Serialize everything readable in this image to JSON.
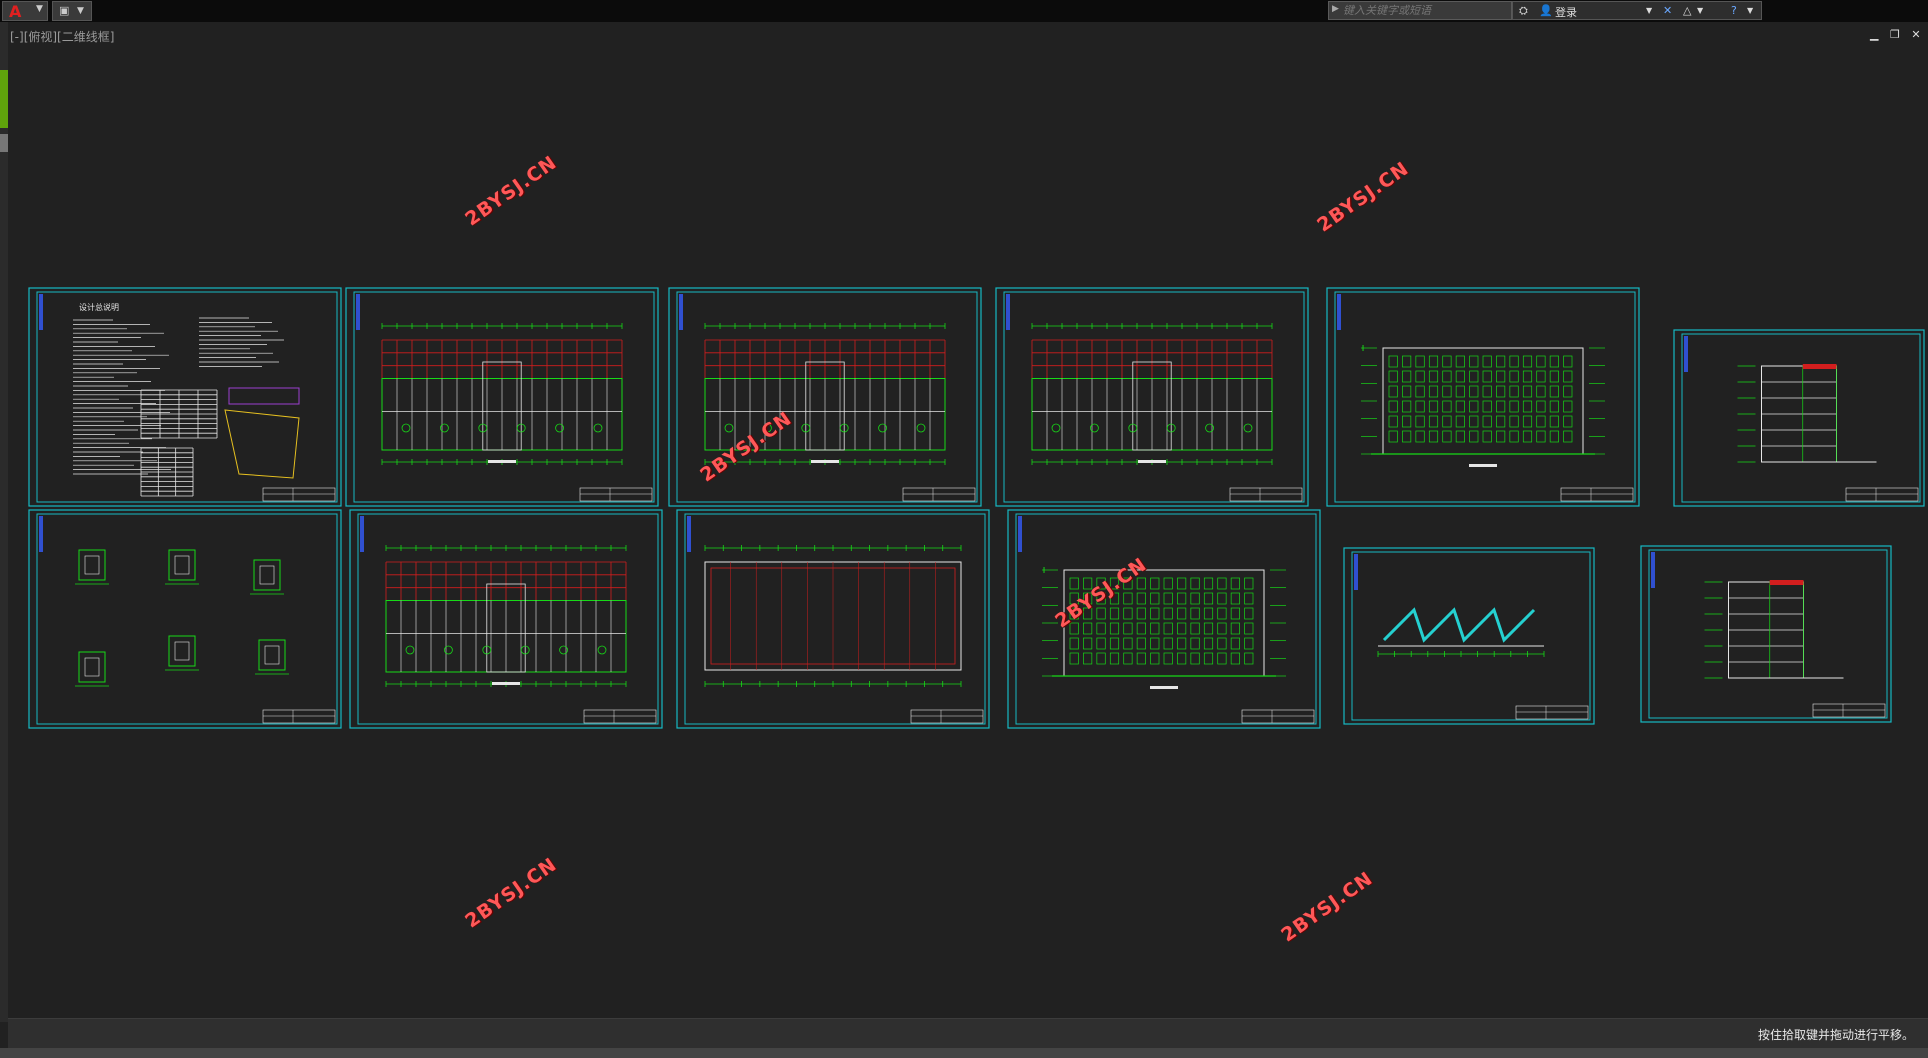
{
  "app": {
    "logo_glyph": "A",
    "quick_access_icons": [
      "save-icon",
      "dropdown-icon"
    ]
  },
  "search": {
    "placeholder": "键入关键字或短语"
  },
  "toolbar_right": {
    "login_label": "登录",
    "icons": [
      "binoculars-icon",
      "user-icon",
      "exchange-icon",
      "network-icon",
      "help-icon"
    ]
  },
  "viewport": {
    "label": "[-][俯视][二维线框]"
  },
  "watermarks": [
    "2BYSJ.CN",
    "2BYSJ.CN",
    "2BYSJ.CN",
    "2BYSJ.CN",
    "2BYSJ.CN",
    "2BYSJ.CN",
    "2BYSJ.CN"
  ],
  "sheets": [
    {
      "type": "notes",
      "title": "设计总说明"
    },
    {
      "type": "plan"
    },
    {
      "type": "plan"
    },
    {
      "type": "plan"
    },
    {
      "type": "elevation"
    },
    {
      "type": "section"
    },
    {
      "type": "details"
    },
    {
      "type": "plan"
    },
    {
      "type": "roof"
    },
    {
      "type": "elevation"
    },
    {
      "type": "stair"
    },
    {
      "type": "section"
    }
  ],
  "status": {
    "message": "按住拾取键并拖动进行平移。"
  },
  "colors": {
    "sheet_border": "#17b9c4",
    "line_green": "#17d917",
    "line_red": "#d21e1e",
    "line_white": "#e6e6e6",
    "watermark": "#ff5858",
    "background": "#212121"
  }
}
